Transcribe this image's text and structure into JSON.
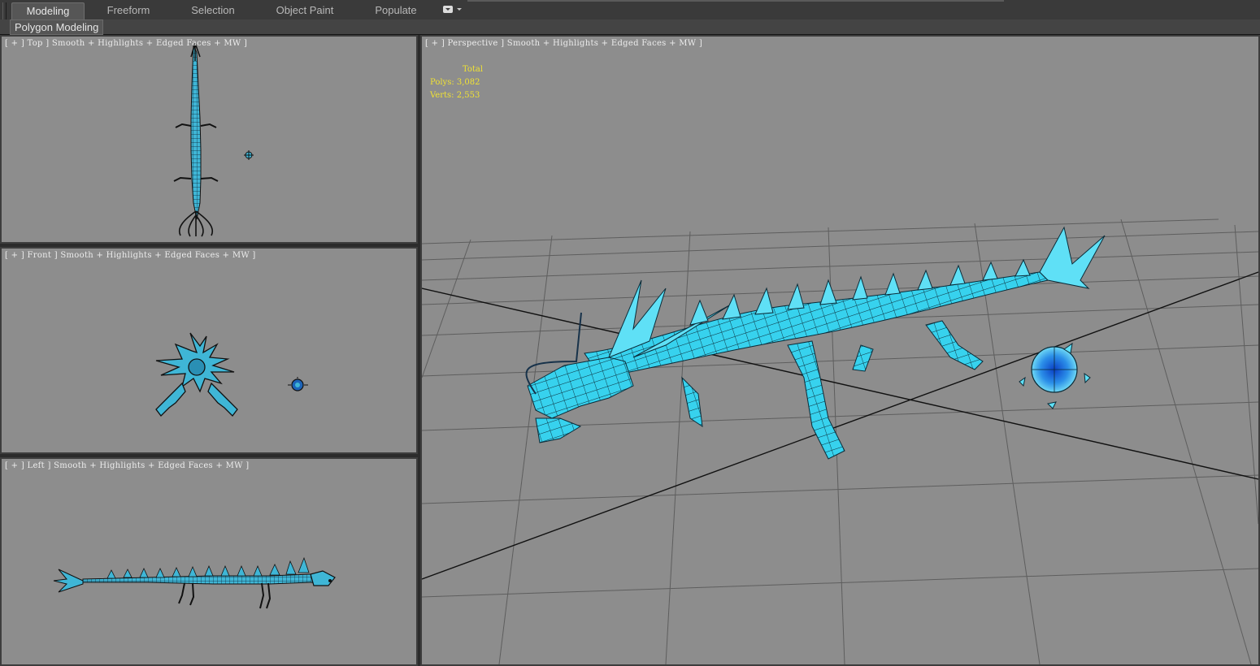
{
  "ribbon": {
    "tabs": [
      {
        "label": "Modeling",
        "active": true
      },
      {
        "label": "Freeform",
        "active": false
      },
      {
        "label": "Selection",
        "active": false
      },
      {
        "label": "Object Paint",
        "active": false
      },
      {
        "label": "Populate",
        "active": false
      }
    ],
    "panel_label": "Polygon Modeling"
  },
  "viewports": {
    "top": {
      "label": "[ + ] Top ] Smooth + Highlights + Edged Faces + MW ]"
    },
    "front": {
      "label": "[ + ] Front ] Smooth + Highlights + Edged Faces + MW ]"
    },
    "left": {
      "label": "[ + ] Left ] Smooth + Highlights + Edged Faces + MW ]"
    },
    "perspective": {
      "label": "[ + ] Perspective ] Smooth + Highlights + Edged Faces + MW ]"
    }
  },
  "stats": {
    "header": "Total",
    "polys_label": "Polys:",
    "polys_value": "3,082",
    "verts_label": "Verts:",
    "verts_value": "2,553"
  },
  "colors": {
    "viewport_bg": "#8d8d8d",
    "model": "#35d0ec",
    "wire": "#0a2a3a",
    "stats_text": "#f0e234"
  }
}
